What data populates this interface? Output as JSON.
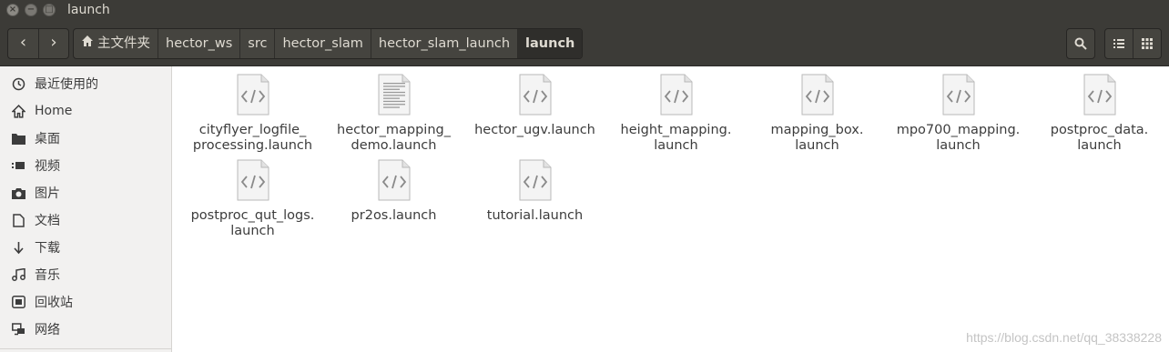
{
  "window": {
    "title": "launch",
    "close_glyph": "×",
    "minimize_glyph": "−",
    "maximize_glyph": "□"
  },
  "toolbar": {
    "back_glyph": "‹",
    "forward_glyph": "›",
    "breadcrumbs": [
      "主文件夹",
      "hector_ws",
      "src",
      "hector_slam",
      "hector_slam_launch",
      "launch"
    ],
    "search_icon": "search-icon",
    "list_view_icon": "list-view-icon",
    "grid_view_icon": "grid-view-icon"
  },
  "sidebar": {
    "items": [
      {
        "label": "最近使用的",
        "icon": "recent-icon"
      },
      {
        "label": "Home",
        "icon": "home-icon"
      },
      {
        "label": "桌面",
        "icon": "desktop-folder-icon"
      },
      {
        "label": "视频",
        "icon": "video-icon"
      },
      {
        "label": "图片",
        "icon": "camera-icon"
      },
      {
        "label": "文档",
        "icon": "document-icon"
      },
      {
        "label": "下载",
        "icon": "download-icon"
      },
      {
        "label": "音乐",
        "icon": "music-icon"
      },
      {
        "label": "回收站",
        "icon": "trash-icon"
      },
      {
        "label": "网络",
        "icon": "network-icon"
      }
    ]
  },
  "files": [
    {
      "line1": "cityflyer_logfile_",
      "line2": "processing.launch",
      "icon": "code-file-icon"
    },
    {
      "line1": "hector_mapping_",
      "line2": "demo.launch",
      "icon": "text-file-icon"
    },
    {
      "line1": "hector_ugv.launch",
      "line2": "",
      "icon": "code-file-icon"
    },
    {
      "line1": "height_mapping.",
      "line2": "launch",
      "icon": "code-file-icon"
    },
    {
      "line1": "mapping_box.",
      "line2": "launch",
      "icon": "code-file-icon"
    },
    {
      "line1": "mpo700_mapping.",
      "line2": "launch",
      "icon": "code-file-icon"
    },
    {
      "line1": "postproc_data.",
      "line2": "launch",
      "icon": "code-file-icon"
    },
    {
      "line1": "postproc_qut_logs.",
      "line2": "launch",
      "icon": "code-file-icon"
    },
    {
      "line1": "pr2os.launch",
      "line2": "",
      "icon": "code-file-icon"
    },
    {
      "line1": "tutorial.launch",
      "line2": "",
      "icon": "code-file-icon"
    }
  ],
  "watermark": "https://blog.csdn.net/qq_38338228"
}
